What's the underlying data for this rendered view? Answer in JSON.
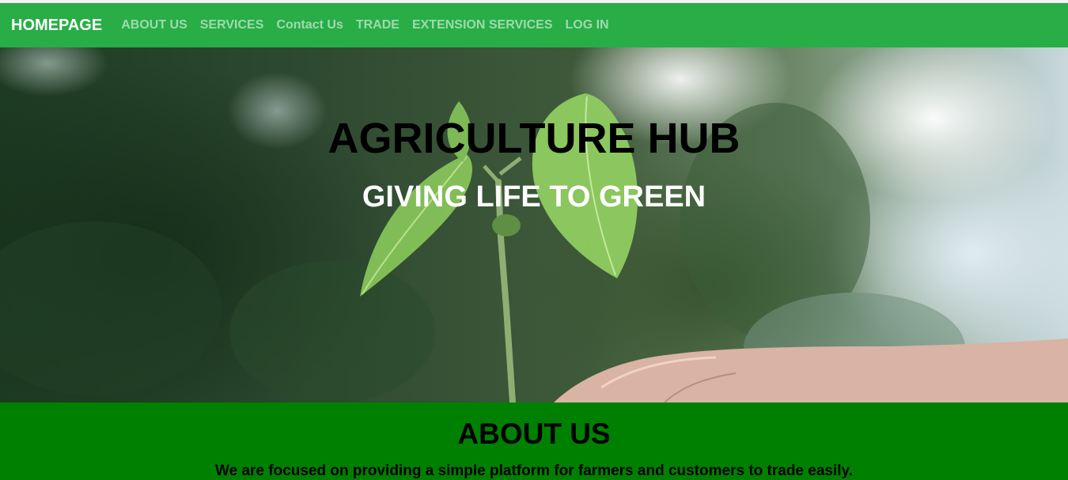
{
  "navbar": {
    "brand": "HOMEPAGE",
    "links": [
      "ABOUT US",
      "SERVICES",
      "Contact Us",
      "TRADE",
      "EXTENSION SERVICES",
      "LOG IN"
    ],
    "background_color": "#28ad47"
  },
  "hero": {
    "title": "AGRICULTURE HUB",
    "subtitle": "GIVING LIFE TO GREEN",
    "image_subject": "seedling-in-hand"
  },
  "about": {
    "title": "ABOUT US",
    "text": "We are focused on providing a simple platform for farmers and customers to trade easily.",
    "background_color": "#008000"
  }
}
